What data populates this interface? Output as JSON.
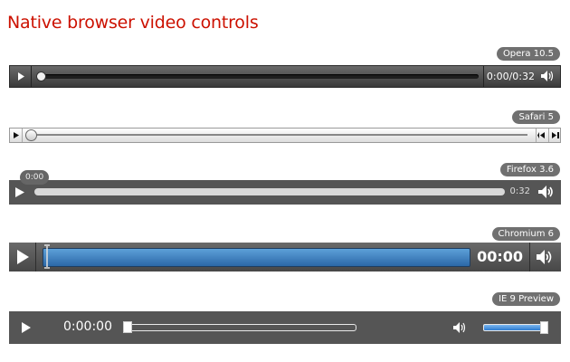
{
  "page_title": "Native browser video controls",
  "players": {
    "opera": {
      "label": "Opera 10.5",
      "time": "0:00/0:32",
      "play_icon": "play-icon",
      "volume_icon": "volume-icon"
    },
    "safari": {
      "label": "Safari 5",
      "play_icon": "play-icon",
      "rewind_icon": "rewind-icon",
      "forward_icon": "forward-icon"
    },
    "firefox": {
      "label": "Firefox 3.6",
      "tooltip_time": "0:00",
      "duration": "0:32",
      "play_icon": "play-icon",
      "volume_icon": "volume-icon"
    },
    "chromium": {
      "label": "Chromium 6",
      "time": "00:00",
      "play_icon": "play-icon",
      "volume_icon": "volume-icon"
    },
    "ie9": {
      "label": "IE 9 Preview",
      "time": "0:00:00",
      "volume_level": 0.95,
      "play_icon": "play-icon",
      "volume_icon": "volume-icon"
    }
  },
  "colors": {
    "title": "#cc1100",
    "tag_bg": "#707070",
    "chromium_progress": "#2b68a8",
    "ie9_volume": "#2d7bd0"
  }
}
